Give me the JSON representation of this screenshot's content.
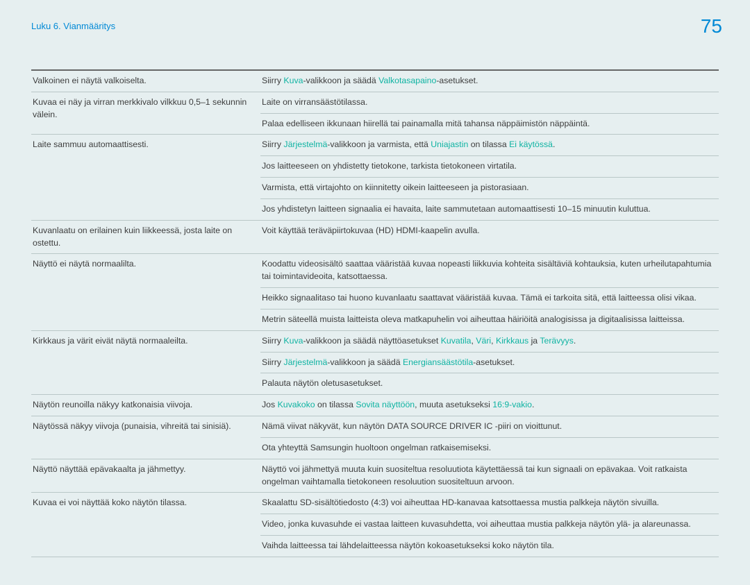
{
  "header": {
    "breadcrumb": "Luku 6. Vianmääritys",
    "page_number": "75"
  },
  "rows": [
    {
      "issue": "Valkoinen ei näytä valkoiselta.",
      "solutions": [
        {
          "parts": [
            "Siirry ",
            [
              "hl",
              "Kuva"
            ],
            "-valikkoon ja säädä ",
            [
              "hl",
              "Valkotasapaino"
            ],
            "-asetukset."
          ]
        }
      ]
    },
    {
      "issue": "Kuvaa ei näy ja virran merkkivalo vilkkuu 0,5–1 sekunnin välein.",
      "solutions": [
        {
          "parts": [
            "Laite on virransäästötilassa."
          ]
        },
        {
          "parts": [
            "Palaa edelliseen ikkunaan hiirellä tai painamalla mitä tahansa näppäimistön näppäintä."
          ]
        }
      ]
    },
    {
      "issue": "Laite sammuu automaattisesti.",
      "solutions": [
        {
          "parts": [
            "Siirry ",
            [
              "hl",
              "Järjestelmä"
            ],
            "-valikkoon ja varmista, että ",
            [
              "hl",
              "Uniajastin"
            ],
            " on tilassa ",
            [
              "hl",
              "Ei käytössä"
            ],
            "."
          ]
        },
        {
          "parts": [
            "Jos laitteeseen on yhdistetty tietokone, tarkista tietokoneen virtatila."
          ]
        },
        {
          "parts": [
            "Varmista, että virtajohto on kiinnitetty oikein laitteeseen ja pistorasiaan."
          ]
        },
        {
          "parts": [
            "Jos yhdistetyn laitteen signaalia ei havaita, laite sammutetaan automaattisesti 10–15 minuutin kuluttua."
          ]
        }
      ]
    },
    {
      "issue": "Kuvanlaatu on erilainen kuin liikkeessä, josta laite on ostettu.",
      "solutions": [
        {
          "parts": [
            "Voit käyttää teräväpiirtokuvaa (HD) HDMI-kaapelin avulla."
          ]
        }
      ]
    },
    {
      "issue": "Näyttö ei näytä normaalilta.",
      "solutions": [
        {
          "parts": [
            "Koodattu videosisältö saattaa vääristää kuvaa nopeasti liikkuvia kohteita sisältäviä kohtauksia, kuten urheilutapahtumia tai toimintavideoita, katsottaessa."
          ]
        },
        {
          "parts": [
            "Heikko signaalitaso tai huono kuvanlaatu saattavat vääristää kuvaa. Tämä ei tarkoita sitä, että laitteessa olisi vikaa."
          ]
        },
        {
          "parts": [
            "Metrin säteellä muista laitteista oleva matkapuhelin voi aiheuttaa häiriöitä analogisissa ja digitaalisissa laitteissa."
          ]
        }
      ]
    },
    {
      "issue": "Kirkkaus ja värit eivät näytä normaaleilta.",
      "solutions": [
        {
          "parts": [
            "Siirry ",
            [
              "hl",
              "Kuva"
            ],
            "-valikkoon ja säädä näyttöasetukset ",
            [
              "hl",
              "Kuvatila"
            ],
            ", ",
            [
              "hl",
              "Väri"
            ],
            ", ",
            [
              "hl",
              "Kirkkaus"
            ],
            " ja ",
            [
              "hl",
              "Terävyys"
            ],
            "."
          ]
        },
        {
          "parts": [
            "Siirry ",
            [
              "hl",
              "Järjestelmä"
            ],
            "-valikkoon ja säädä ",
            [
              "hl",
              "Energiansäästötila"
            ],
            "-asetukset."
          ]
        },
        {
          "parts": [
            "Palauta näytön oletusasetukset."
          ]
        }
      ]
    },
    {
      "issue": "Näytön reunoilla näkyy katkonaisia viivoja.",
      "solutions": [
        {
          "parts": [
            "Jos ",
            [
              "hl",
              "Kuvakoko"
            ],
            " on tilassa ",
            [
              "hl",
              "Sovita näyttöön"
            ],
            ", muuta asetukseksi ",
            [
              "hl",
              "16:9-vakio"
            ],
            "."
          ]
        }
      ]
    },
    {
      "issue": "Näytössä näkyy viivoja (punaisia, vihreitä tai sinisiä).",
      "solutions": [
        {
          "parts": [
            "Nämä viivat näkyvät, kun näytön DATA SOURCE DRIVER IC -piiri on vioittunut."
          ]
        },
        {
          "parts": [
            "Ota yhteyttä Samsungin huoltoon ongelman ratkaisemiseksi."
          ]
        }
      ]
    },
    {
      "issue": "Näyttö näyttää epävakaalta ja jähmettyy.",
      "solutions": [
        {
          "parts": [
            "Näyttö voi jähmettyä muuta kuin suositeltua resoluutiota käytettäessä tai kun signaali on epävakaa. Voit ratkaista ongelman vaihtamalla tietokoneen resoluution suositeltuun arvoon."
          ]
        }
      ]
    },
    {
      "issue": "Kuvaa ei voi näyttää koko näytön tilassa.",
      "solutions": [
        {
          "parts": [
            "Skaalattu SD-sisältötiedosto (4:3) voi aiheuttaa HD-kanavaa katsottaessa mustia palkkeja näytön sivuilla."
          ]
        },
        {
          "parts": [
            "Video, jonka kuvasuhde ei vastaa laitteen kuvasuhdetta, voi aiheuttaa mustia palkkeja näytön ylä- ja alareunassa."
          ]
        },
        {
          "parts": [
            "Vaihda laitteessa tai lähdelaitteessa näytön kokoasetukseksi koko näytön tila."
          ]
        }
      ]
    }
  ]
}
